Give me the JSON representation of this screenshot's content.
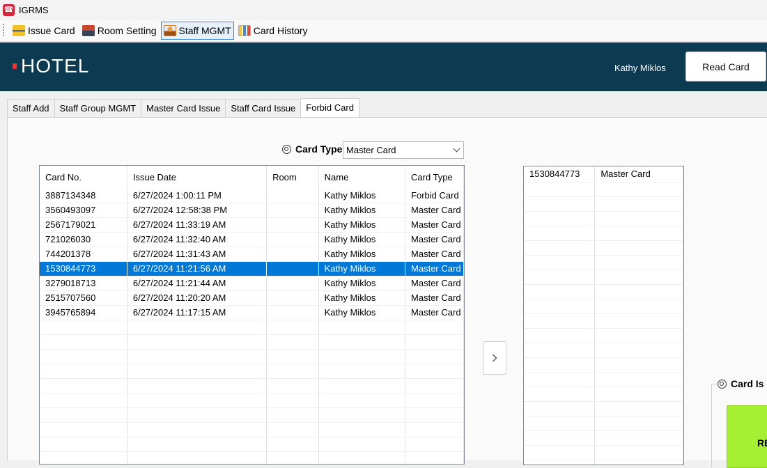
{
  "window": {
    "title": "IGRMS"
  },
  "toolbar": {
    "items": [
      {
        "label": "Issue Card",
        "icon": "issue-card-icon",
        "active": false
      },
      {
        "label": "Room Setting",
        "icon": "room-setting-icon",
        "active": false
      },
      {
        "label": "Staff MGMT",
        "icon": "staff-icon",
        "active": true
      },
      {
        "label": "Card History",
        "icon": "chart-icon",
        "active": false
      }
    ]
  },
  "header": {
    "logo": "HOTEL",
    "user_name": "Kathy Miklos",
    "read_card_label": "Read Card",
    "background": "#0c3a51"
  },
  "tabs": [
    {
      "label": "Staff Add",
      "active": false
    },
    {
      "label": "Staff Group MGMT",
      "active": false
    },
    {
      "label": "Master Card Issue",
      "active": false
    },
    {
      "label": "Staff Card Issue",
      "active": false
    },
    {
      "label": "Forbid Card",
      "active": true
    }
  ],
  "card_type": {
    "label": "Card Type",
    "selected": "Master Card"
  },
  "cards_table": {
    "columns": [
      "Card No.",
      "Issue Date",
      "Room",
      "Name",
      "Card Type"
    ],
    "rows": [
      [
        "3887134348",
        "6/27/2024 1:00:11 PM",
        "",
        "Kathy Miklos",
        "Forbid Card"
      ],
      [
        "3560493097",
        "6/27/2024 12:58:38 PM",
        "",
        "Kathy Miklos",
        "Master Card"
      ],
      [
        "2567179021",
        "6/27/2024 11:33:19 AM",
        "",
        "Kathy Miklos",
        "Master Card"
      ],
      [
        "721026030",
        "6/27/2024 11:32:40 AM",
        "",
        "Kathy Miklos",
        "Master Card"
      ],
      [
        "744201378",
        "6/27/2024 11:31:43 AM",
        "",
        "Kathy Miklos",
        "Master Card"
      ],
      [
        "1530844773",
        "6/27/2024 11:21:56 AM",
        "",
        "Kathy Miklos",
        "Master Card"
      ],
      [
        "3279018713",
        "6/27/2024 11:21:44 AM",
        "",
        "Kathy Miklos",
        "Master Card"
      ],
      [
        "2515707560",
        "6/27/2024 11:20:20 AM",
        "",
        "Kathy Miklos",
        "Master Card"
      ],
      [
        "3945765894",
        "6/27/2024 11:17:15 AM",
        "",
        "Kathy Miklos",
        "Master Card"
      ]
    ],
    "selected_row": 5,
    "selection_color": "#0078d7"
  },
  "move_button": {
    "icon": "chevron-right-icon",
    "label": "›"
  },
  "selected_table": {
    "rows": [
      [
        "1530844773",
        "Master Card"
      ]
    ]
  },
  "card_issue_group": {
    "label": "Card Is"
  },
  "issue_button": {
    "label": "RE",
    "color": "#a6f034"
  }
}
